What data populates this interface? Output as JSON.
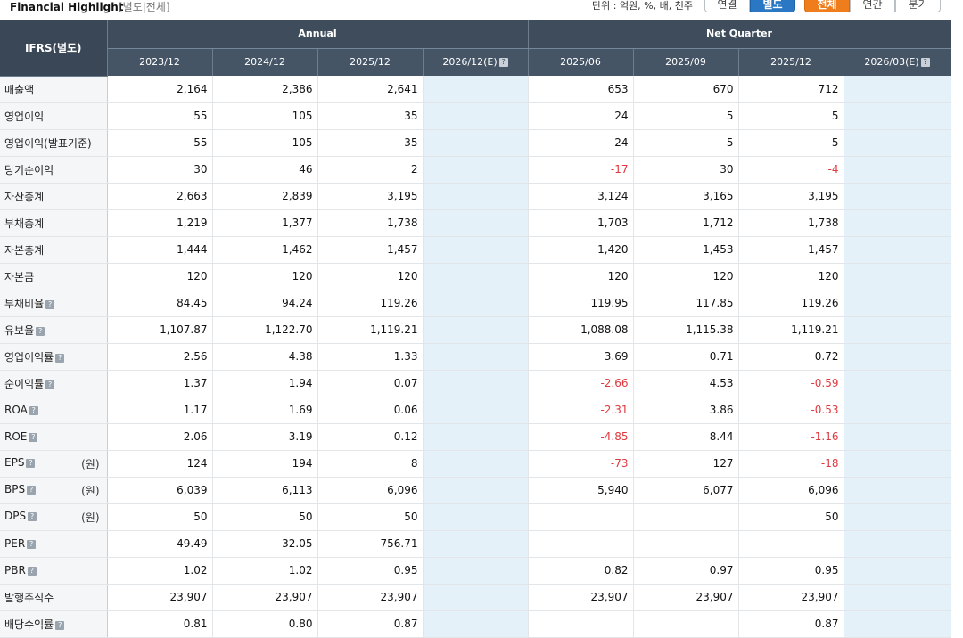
{
  "header": {
    "title": "Financial Highlight",
    "subtitle": "[별도|전체]",
    "unit": "단위 : 억원, %, 배, 천주"
  },
  "toggles": {
    "basis": [
      {
        "label": "연결",
        "selected": false
      },
      {
        "label": "별도",
        "selected": true
      }
    ],
    "period": [
      {
        "label": "전체",
        "selected": true
      },
      {
        "label": "연간",
        "selected": false
      },
      {
        "label": "분기",
        "selected": false
      }
    ]
  },
  "table": {
    "corner": "IFRS(별도)",
    "groups": {
      "annual": "Annual",
      "quarter": "Net Quarter"
    },
    "columns": [
      "2023/12",
      "2024/12",
      "2025/12",
      "2026/12(E)",
      "2025/06",
      "2025/09",
      "2025/12",
      "2026/03(E)"
    ],
    "rows": [
      {
        "label": "매출액",
        "unit": "",
        "values": [
          "2,164",
          "2,386",
          "2,641",
          "",
          "653",
          "670",
          "712",
          ""
        ]
      },
      {
        "label": "영업이익",
        "unit": "",
        "values": [
          "55",
          "105",
          "35",
          "",
          "24",
          "5",
          "5",
          ""
        ]
      },
      {
        "label": "영업이익(발표기준)",
        "unit": "",
        "values": [
          "55",
          "105",
          "35",
          "",
          "24",
          "5",
          "5",
          ""
        ]
      },
      {
        "label": "당기순이익",
        "unit": "",
        "values": [
          "30",
          "46",
          "2",
          "",
          "-17",
          "30",
          "-4",
          ""
        ]
      },
      {
        "label": "자산총계",
        "unit": "",
        "values": [
          "2,663",
          "2,839",
          "3,195",
          "",
          "3,124",
          "3,165",
          "3,195",
          ""
        ]
      },
      {
        "label": "부채총계",
        "unit": "",
        "values": [
          "1,219",
          "1,377",
          "1,738",
          "",
          "1,703",
          "1,712",
          "1,738",
          ""
        ]
      },
      {
        "label": "자본총계",
        "unit": "",
        "values": [
          "1,444",
          "1,462",
          "1,457",
          "",
          "1,420",
          "1,453",
          "1,457",
          ""
        ]
      },
      {
        "label": "자본금",
        "unit": "",
        "values": [
          "120",
          "120",
          "120",
          "",
          "120",
          "120",
          "120",
          ""
        ]
      },
      {
        "label": "부채비율",
        "unit": "",
        "values": [
          "84.45",
          "94.24",
          "119.26",
          "",
          "119.95",
          "117.85",
          "119.26",
          ""
        ]
      },
      {
        "label": "유보율",
        "unit": "",
        "values": [
          "1,107.87",
          "1,122.70",
          "1,119.21",
          "",
          "1,088.08",
          "1,115.38",
          "1,119.21",
          ""
        ]
      },
      {
        "label": "영업이익률",
        "unit": "",
        "values": [
          "2.56",
          "4.38",
          "1.33",
          "",
          "3.69",
          "0.71",
          "0.72",
          ""
        ]
      },
      {
        "label": "순이익률",
        "unit": "",
        "values": [
          "1.37",
          "1.94",
          "0.07",
          "",
          "-2.66",
          "4.53",
          "-0.59",
          ""
        ]
      },
      {
        "label": "ROA",
        "unit": "",
        "values": [
          "1.17",
          "1.69",
          "0.06",
          "",
          "-2.31",
          "3.86",
          "-0.53",
          ""
        ]
      },
      {
        "label": "ROE",
        "unit": "",
        "values": [
          "2.06",
          "3.19",
          "0.12",
          "",
          "-4.85",
          "8.44",
          "-1.16",
          ""
        ]
      },
      {
        "label": "EPS",
        "unit": "(원)",
        "values": [
          "124",
          "194",
          "8",
          "",
          "-73",
          "127",
          "-18",
          ""
        ]
      },
      {
        "label": "BPS",
        "unit": "(원)",
        "values": [
          "6,039",
          "6,113",
          "6,096",
          "",
          "5,940",
          "6,077",
          "6,096",
          ""
        ]
      },
      {
        "label": "DPS",
        "unit": "(원)",
        "values": [
          "50",
          "50",
          "50",
          "",
          "",
          "",
          "50",
          ""
        ]
      },
      {
        "label": "PER",
        "unit": "",
        "values": [
          "49.49",
          "32.05",
          "756.71",
          "",
          "",
          "",
          "",
          ""
        ]
      },
      {
        "label": "PBR",
        "unit": "",
        "values": [
          "1.02",
          "1.02",
          "0.95",
          "",
          "0.82",
          "0.97",
          "0.95",
          ""
        ]
      },
      {
        "label": "발행주식수",
        "unit": "",
        "values": [
          "23,907",
          "23,907",
          "23,907",
          "",
          "23,907",
          "23,907",
          "23,907",
          ""
        ]
      },
      {
        "label": "배당수익률",
        "unit": "",
        "values": [
          "0.81",
          "0.80",
          "0.87",
          "",
          "",
          "",
          "0.87",
          ""
        ]
      }
    ]
  },
  "colors": {
    "header_bg": "#3e4c5b",
    "negative": "#e0383e",
    "estimate_bg": "#e5f1f8",
    "selected_blue": "#2a78c4",
    "selected_orange": "#f07d1c"
  }
}
